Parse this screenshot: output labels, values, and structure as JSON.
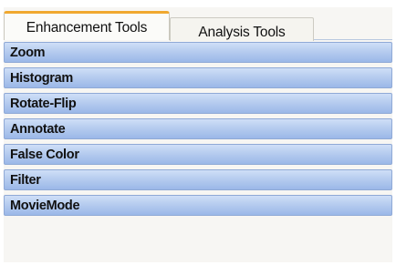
{
  "tabs": [
    {
      "label": "Enhancement Tools",
      "active": true
    },
    {
      "label": "Analysis Tools",
      "active": false
    }
  ],
  "sections": [
    {
      "label": "Zoom"
    },
    {
      "label": "Histogram"
    },
    {
      "label": "Rotate-Flip"
    },
    {
      "label": "Annotate"
    },
    {
      "label": "False Color"
    },
    {
      "label": "Filter"
    },
    {
      "label": "MovieMode"
    }
  ],
  "colors": {
    "active_tab_accent": "#f0a830",
    "bar_gradient_top": "#cfdff7",
    "bar_gradient_bottom": "#9bb8e8",
    "bar_border": "#8fa9d6"
  }
}
